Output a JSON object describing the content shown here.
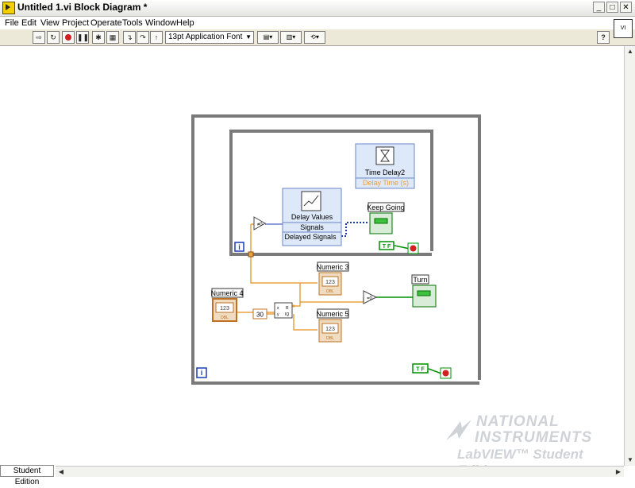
{
  "window": {
    "title": "Untitled 1.vi Block Diagram *",
    "minimize": "_",
    "maximize": "□",
    "close": "✕"
  },
  "menu": {
    "items": [
      "File",
      "Edit",
      "View",
      "Project",
      "Operate",
      "Tools",
      "Window",
      "Help"
    ]
  },
  "toolbar": {
    "font": "13pt Application Font",
    "help": "?"
  },
  "diagram": {
    "delay_values": {
      "title": "Delay Values",
      "in": "Signals",
      "out": "Delayed Signals"
    },
    "time_delay": {
      "title": "Time Delay2",
      "param": "Delay Time (s)"
    },
    "keep_going": "Keep Going",
    "turn": "Turn",
    "numeric3": "Numeric 3",
    "numeric4": "Numeric 4",
    "numeric5": "Numeric 5",
    "const30": "30",
    "ind_text": "123",
    "ind_sub": "DBL",
    "iter": "i",
    "bool_const": "T F",
    "neq_zero": "≠0",
    "eq_zero": "=0",
    "quotient_r": "R",
    "quotient_iq": "IQ",
    "quotient_x": "x",
    "quotient_y": "y"
  },
  "statusbar": {
    "edition": "Student Edition"
  },
  "watermark": {
    "line1": "NATIONAL",
    "line2": "INSTRUMENTS",
    "line3": "LabVIEW™ Student Edition"
  },
  "colors": {
    "orange_wire": "#e8a040",
    "green_bool": "#009000",
    "frame": "#7a7a7a",
    "blue": "#1a3ab8"
  }
}
